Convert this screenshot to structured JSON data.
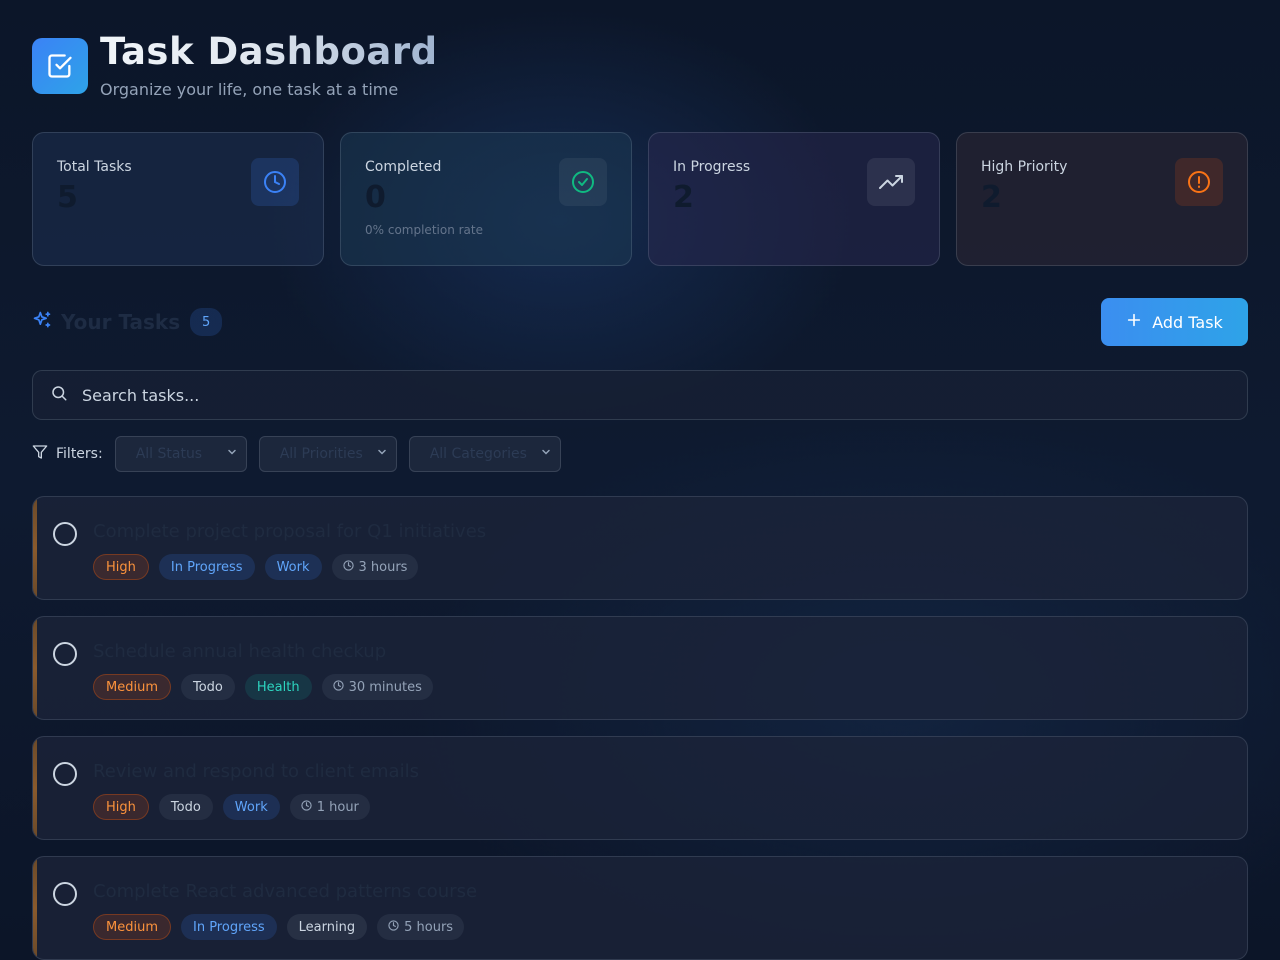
{
  "header": {
    "title": "Task Dashboard",
    "subtitle": "Organize your life, one task at a time",
    "logo_icon": "check-square-icon"
  },
  "stats": [
    {
      "label": "Total Tasks",
      "value": "5",
      "sub": "",
      "icon": "clock-icon",
      "color": "#3b82f6"
    },
    {
      "label": "Completed",
      "value": "0",
      "sub": "0% completion rate",
      "icon": "check-circle-icon",
      "color": "#10b981"
    },
    {
      "label": "In Progress",
      "value": "2",
      "sub": "",
      "icon": "trending-up-icon",
      "color": "#cbd5e1"
    },
    {
      "label": "High Priority",
      "value": "2",
      "sub": "",
      "icon": "alert-circle-icon",
      "color": "#f97316"
    }
  ],
  "tasks_section": {
    "title": "Your Tasks",
    "count": "5",
    "add_label": "Add Task"
  },
  "search": {
    "placeholder": "Search tasks..."
  },
  "filters": {
    "label": "Filters:",
    "status": "All Status",
    "priority": "All Priorities",
    "category": "All Categories"
  },
  "tasks": [
    {
      "title": "Complete project proposal for Q1 initiatives",
      "priority": "High",
      "status": "In Progress",
      "category": "Work",
      "time": "3 hours"
    },
    {
      "title": "Schedule annual health checkup",
      "priority": "Medium",
      "status": "Todo",
      "category": "Health",
      "time": "30 minutes"
    },
    {
      "title": "Review and respond to client emails",
      "priority": "High",
      "status": "Todo",
      "category": "Work",
      "time": "1 hour"
    },
    {
      "title": "Complete React advanced patterns course",
      "priority": "Medium",
      "status": "In Progress",
      "category": "Learning",
      "time": "5 hours"
    }
  ],
  "colors": {
    "accent": "#3b82f6",
    "priority": "#fb923c",
    "health": "#2dd4bf",
    "background": "#0c1629"
  }
}
